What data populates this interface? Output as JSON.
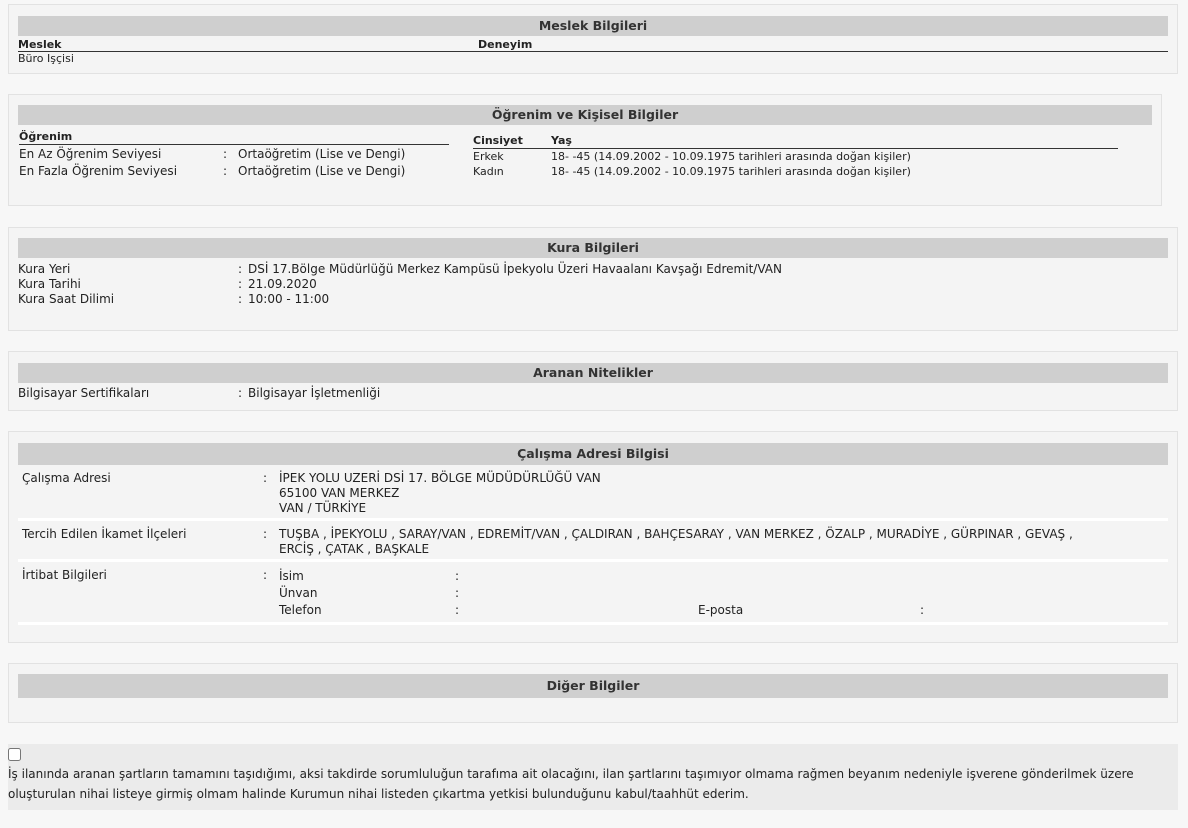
{
  "meslek": {
    "title": "Meslek Bilgileri",
    "col_meslek": "Meslek",
    "col_deneyim": "Deneyim",
    "value_meslek": "Büro Işçisi"
  },
  "ogrenim": {
    "title": "Öğrenim ve Kişisel Bilgiler",
    "col_ogrenim": "Öğrenim",
    "rows": [
      {
        "label": "En Az Öğrenim Seviyesi",
        "sep": ":",
        "value": "Ortaöğretim (Lise ve Dengi)"
      },
      {
        "label": "En Fazla Öğrenim Seviyesi",
        "sep": ":",
        "value": "Ortaöğretim (Lise ve Dengi)"
      }
    ],
    "col_cinsiyet": "Cinsiyet",
    "col_yas": "Yaş",
    "persons": [
      {
        "gender": "Erkek",
        "age": "18- -45 (14.09.2002 - 10.09.1975 tarihleri arasında doğan kişiler)"
      },
      {
        "gender": "Kadın",
        "age": "18- -45 (14.09.2002 - 10.09.1975 tarihleri arasında doğan kişiler)"
      }
    ]
  },
  "kura": {
    "title": "Kura Bilgileri",
    "rows": [
      {
        "label": "Kura Yeri",
        "sep": ":",
        "value": "DSİ 17.Bölge Müdürlüğü Merkez Kampüsü İpekyolu Üzeri Havaalanı Kavşağı Edremit/VAN"
      },
      {
        "label": "Kura Tarihi",
        "sep": ":",
        "value": "21.09.2020"
      },
      {
        "label": "Kura Saat Dilimi",
        "sep": ":",
        "value": "10:00 - 11:00"
      }
    ]
  },
  "nitelik": {
    "title": "Aranan Nitelikler",
    "label": "Bilgisayar Sertifikaları",
    "sep": ":",
    "value": "Bilgisayar İşletmenliği"
  },
  "adres": {
    "title": "Çalışma Adresi Bilgisi",
    "calisma_label": "Çalışma Adresi",
    "sep": ":",
    "address_lines": [
      "İPEK YOLU UZERİ DSİ 17. BÖLGE MÜDÜDÜRLÜĞÜ VAN",
      "65100 VAN MERKEZ",
      "VAN / TÜRKİYE"
    ],
    "ikamet_label": "Tercih Edilen İkamet İlçeleri",
    "ilceler_line1": "TUŞBA ,  İPEKYOLU ,  SARAY/VAN ,  EDREMİT/VAN ,  ÇALDIRAN ,  BAHÇESARAY ,  VAN MERKEZ ,  ÖZALP ,  MURADİYE ,  GÜRPINAR ,  GEVAŞ ,",
    "ilceler_line2": "ERCİŞ ,  ÇATAK ,  BAŞKALE",
    "irtibat_label": "İrtibat Bilgileri",
    "isim_label": "İsim",
    "unvan_label": "Ünvan",
    "telefon_label": "Telefon",
    "eposta_label": "E-posta",
    "colon": ":"
  },
  "diger": {
    "title": "Diğer Bilgiler"
  },
  "consent": {
    "text": "İş ilanında aranan şartların tamamını taşıdığımı, aksi takdirde sorumluluğun tarafıma ait olacağını, ilan şartlarını taşımıyor olmama rağmen beyanım nedeniyle işverene gönderilmek üzere oluşturulan nihai listeye girmiş olmam halinde Kurumun nihai listeden çıkartma yetkisi bulunduğunu kabul/taahhüt ederim."
  }
}
